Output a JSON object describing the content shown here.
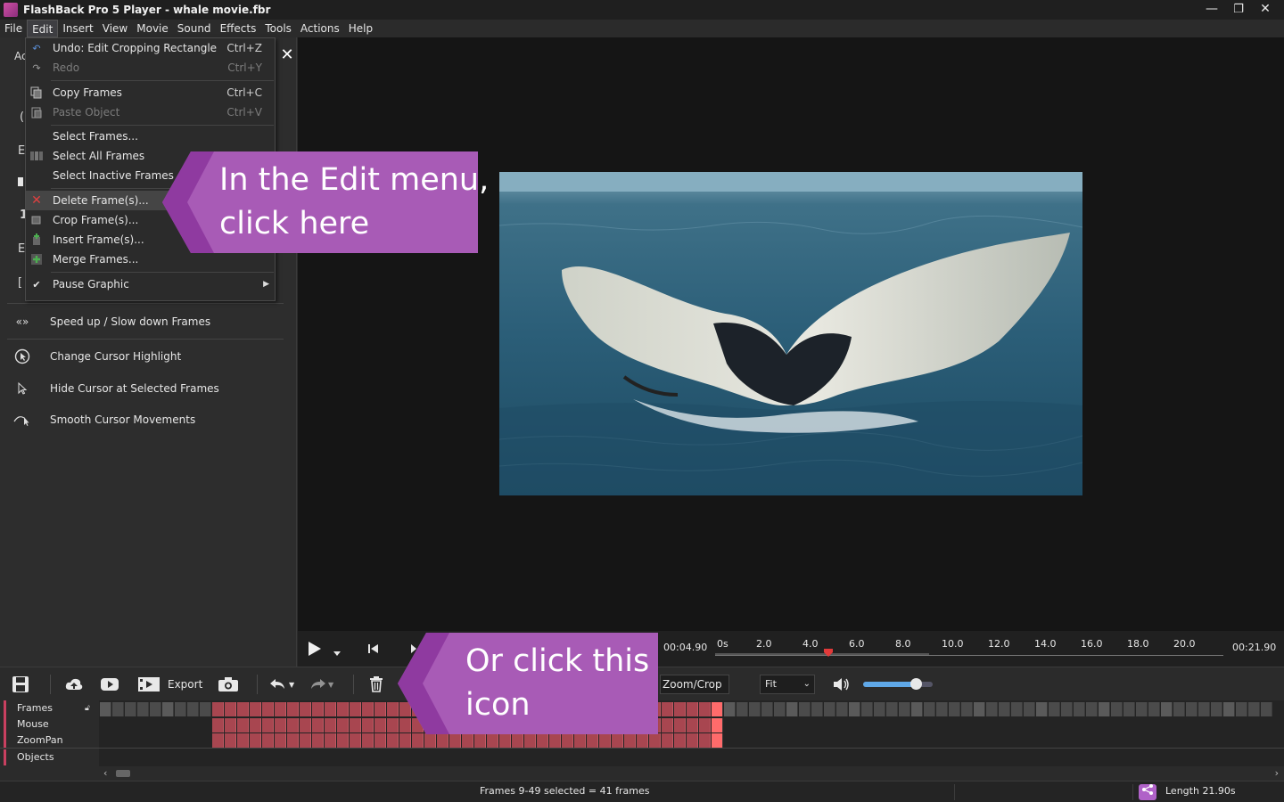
{
  "window": {
    "title": "FlashBack Pro 5 Player - whale movie.fbr",
    "minimize_glyph": "—",
    "restore_glyph": "❐",
    "close_glyph": "✕"
  },
  "menubar": {
    "items": [
      "File",
      "Edit",
      "Insert",
      "View",
      "Movie",
      "Sound",
      "Effects",
      "Tools",
      "Actions",
      "Help"
    ],
    "active": "Edit"
  },
  "edit_menu": {
    "items": [
      {
        "label": "Undo: Edit Cropping Rectangle",
        "shortcut": "Ctrl+Z",
        "icon": "undo-icon",
        "disabled": false
      },
      {
        "label": "Redo",
        "shortcut": "Ctrl+Y",
        "icon": "redo-icon",
        "disabled": true
      },
      {
        "label": "Copy Frames",
        "shortcut": "Ctrl+C",
        "icon": "copy-icon",
        "disabled": false
      },
      {
        "label": "Paste Object",
        "shortcut": "Ctrl+V",
        "icon": "paste-icon",
        "disabled": true
      },
      {
        "label": "Select Frames...",
        "shortcut": "",
        "icon": "",
        "disabled": false
      },
      {
        "label": "Select All Frames",
        "shortcut": "",
        "icon": "select-all-icon",
        "disabled": false
      },
      {
        "label": "Select Inactive Frames",
        "shortcut": "",
        "icon": "",
        "disabled": false
      },
      {
        "label": "Delete Frame(s)...",
        "shortcut": "",
        "icon": "delete-icon",
        "disabled": false,
        "highlighted": true
      },
      {
        "label": "Crop Frame(s)...",
        "shortcut": "",
        "icon": "crop-icon",
        "disabled": false
      },
      {
        "label": "Insert Frame(s)...",
        "shortcut": "",
        "icon": "insert-icon",
        "disabled": false
      },
      {
        "label": "Merge Frames...",
        "shortcut": "",
        "icon": "merge-icon",
        "disabled": false
      },
      {
        "label": "Pause Graphic",
        "shortcut": "",
        "icon": "check-icon",
        "disabled": false,
        "submenu": true
      }
    ]
  },
  "left_panel": {
    "tab_fragment": "Ac",
    "items": [
      {
        "label": "Speed up / Slow down Frames",
        "icon": "speed-icon"
      },
      {
        "label": "Change Cursor Highlight",
        "icon": "cursor-highlight-icon"
      },
      {
        "label": "Hide Cursor at Selected Frames",
        "icon": "cursor-icon"
      },
      {
        "label": "Smooth Cursor Movements",
        "icon": "smooth-cursor-icon"
      }
    ],
    "fragments": [
      "",
      "(",
      "E",
      "",
      "1",
      "E",
      "["
    ]
  },
  "playbar": {
    "current_time": "00:04.90",
    "total_time": "00:21.90",
    "ticks": [
      "0s",
      "2.0",
      "4.0",
      "6.0",
      "8.0",
      "10.0",
      "12.0",
      "14.0",
      "16.0",
      "18.0",
      "20.0"
    ],
    "playhead_seconds": 4.9,
    "length_seconds": 21.9
  },
  "toolbar": {
    "export_label": "Export",
    "zoom_crop_label": "Zoom/Crop",
    "fit_label": "Fit",
    "volume": 0.75
  },
  "tracks": {
    "labels": [
      "Frames",
      "Mouse",
      "ZoomPan",
      "Objects"
    ],
    "total_frames": 94,
    "selected_first": 9,
    "selected_last": 49,
    "current_frame": 49
  },
  "status": {
    "selection": "Frames 9-49 selected = 41 frames",
    "length": "Length 21.90s"
  },
  "callouts": {
    "edit_menu": [
      "In the Edit menu,",
      "click here"
    ],
    "toolbar": [
      "Or click this",
      "icon"
    ],
    "color": "#a85bb6",
    "edge_color": "#8f3aa0"
  },
  "colors": {
    "selected_frame": "#a84650",
    "current_frame": "#ff6b6b",
    "delete_icon": "#e04040"
  }
}
